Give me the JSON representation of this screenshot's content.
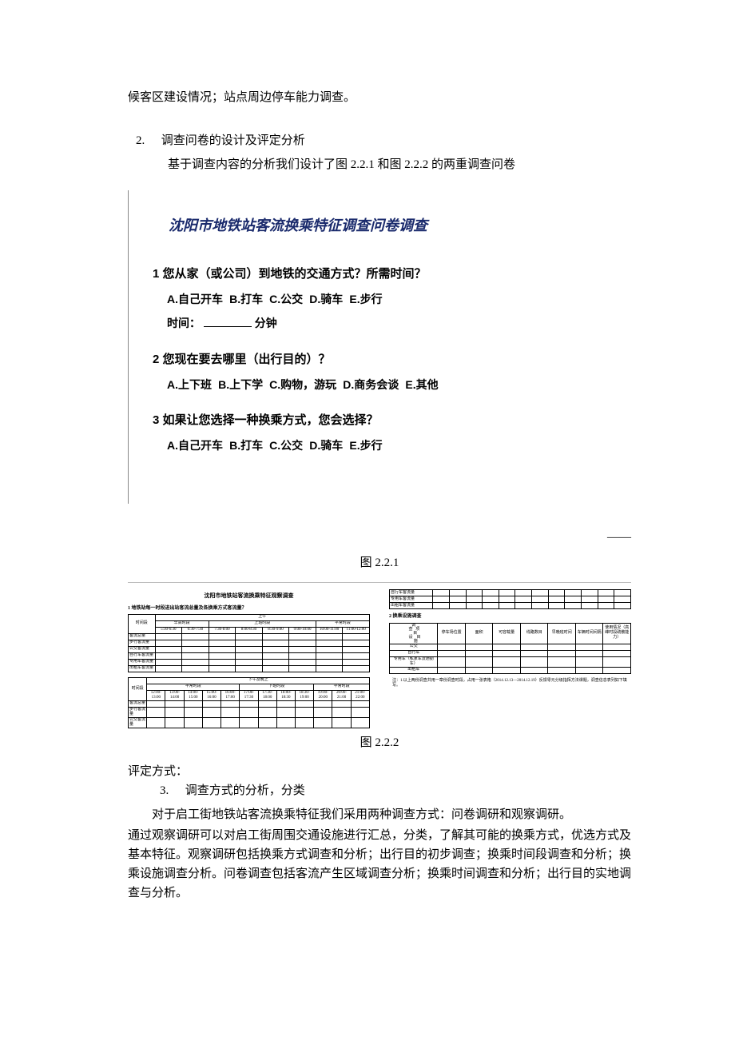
{
  "intro": "候客区建设情况；站点周边停车能力调查。",
  "item2": {
    "num": "2.",
    "title": "调查问卷的设计及评定分析"
  },
  "item2_para": "基于调查内容的分析我们设计了图 2.2.1 和图 2.2.2 的两重调查问卷",
  "survey_title": "沈阳市地铁站客流换乘特征调查问卷调查",
  "q1": {
    "head": "1  您从家（或公司）到地铁的交通方式？所需时间？",
    "opts": "A.自己开车   B.打车   C.公交   D.骑车   E.步行",
    "time_prefix": "时间：",
    "time_suffix": "分钟"
  },
  "q2": {
    "head": "2  您现在要去哪里（出行目的）？",
    "opts": "A.上下班  B.上下学  C.购物，游玩  D.商务会谈  E.其他"
  },
  "q3": {
    "head": "3  如果让您选择一种换乘方式，您会选择？",
    "opts": "A.自己开车   B.打车   C.公交   D.骑车   E.步行"
  },
  "dash": "——",
  "fig1": "图 2.2.1",
  "fig2": "图 2.2.2",
  "mini_left": {
    "title": "沈阳市地铁站客流换乘特征观察调查",
    "sub1": "1  地铁站每一时段进出站客流总量及各换乘方式客流量？",
    "top_group": "上午",
    "span_label": "时间段",
    "groups1": [
      "早高时段",
      "上班时段",
      "平常时段"
    ],
    "cols1": [
      "5:30-6:30",
      "6:30-7:30",
      "7:30-8:00",
      "8:00-8:30",
      "8:30-9:00",
      "9:00-10:00",
      "10:00-11:00",
      "11:00-12:00"
    ],
    "rows1": [
      "客流总量",
      "步行客流量",
      "公交客流量",
      "自行车客流量",
      "专用车客流量",
      "出租车客流量"
    ],
    "top_group2": "下午及晚上",
    "groups2": [
      "平常时段",
      "下班时段",
      "平常时段"
    ],
    "cols2": [
      "12:00-13:00",
      "13:00-14:00",
      "14:00-15:00",
      "15:00-16:00",
      "16:00-17:00",
      "17:00-17:30",
      "17:30-18:00",
      "18:00-18:30",
      "18:30-19:00",
      "19:00-20:00",
      "20:00-21:00",
      "21:00-22:00"
    ],
    "rows2": [
      "客流总量",
      "步行客流量",
      "公交客流量"
    ]
  },
  "mini_right": {
    "rows_top": [
      "自行车客流量",
      "专用车客流量",
      "出租车客流量"
    ],
    "sub2": "2  换乘设施调查",
    "head2": [
      "停车场位置",
      "面积",
      "可容载量",
      "线路数目",
      "早晚班时间",
      "车辆时间间隔",
      "使用情况（高峰时段疏散能力）"
    ],
    "rows3": [
      "公交",
      "自行车",
      "专用车（私家车及通勤车）",
      "出租车"
    ],
    "note": "注：1.以上两份调查共用一章份调查时段，占用一张表格（2014.12.13—2014.12.19）反馈零元分级指挥方法课题，调查信息表列如下填写。"
  },
  "eval": "评定方式：",
  "item3": {
    "num": "3.",
    "title": "调查方式的分析，分类"
  },
  "para1": "对于启工街地铁站客流换乘特征我们采用两种调查方式：问卷调研和观察调研。",
  "para2": "通过观察调研可以对启工街周围交通设施进行汇总，分类，了解其可能的换乘方式，优选方式及基本特征。观察调研包括换乘方式调查和分析；出行目的初步调查；换乘时间段调查和分析；换乘设施调查分析。问卷调查包括客流产生区域调查分析；换乘时间调查和分析；出行目的实地调查与分析。"
}
